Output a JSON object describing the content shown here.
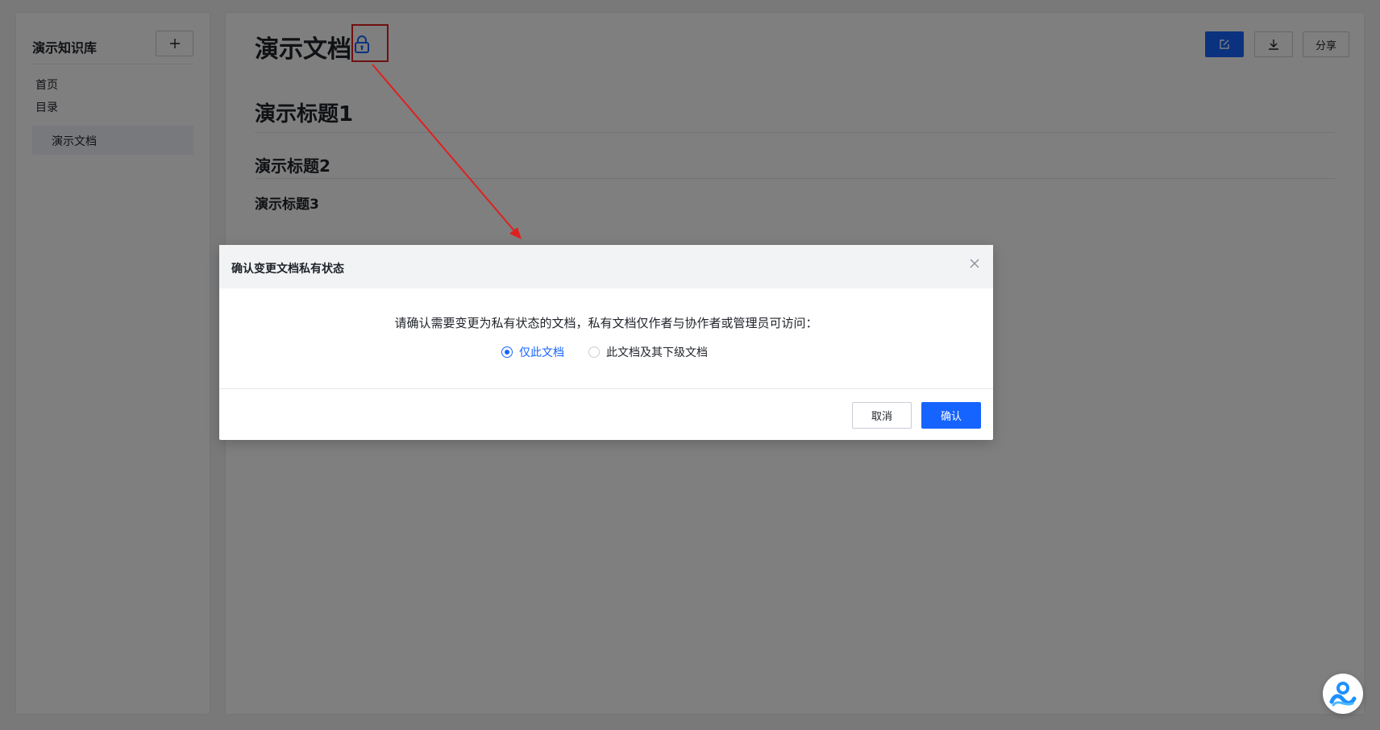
{
  "sidebar": {
    "title": "演示知识库",
    "nav": [
      "首页",
      "目录"
    ],
    "active_doc": "演示文档"
  },
  "main": {
    "doc_title": "演示文档",
    "toolbar": {
      "share_label": "分享"
    },
    "headings": [
      "演示标题1",
      "演示标题2",
      "演示标题3"
    ]
  },
  "modal": {
    "title": "确认变更文档私有状态",
    "message": "请确认需要变更为私有状态的文档，私有文档仅作者与协作者或管理员可访问：",
    "options": [
      {
        "label": "仅此文档",
        "checked": true
      },
      {
        "label": "此文档及其下级文档",
        "checked": false
      }
    ],
    "cancel_label": "取消",
    "confirm_label": "确认"
  },
  "colors": {
    "accent": "#1664ff",
    "annotation": "#e02020"
  },
  "icons": [
    "plus-icon",
    "lock-icon",
    "edit-icon",
    "download-icon",
    "close-icon",
    "assistant-icon"
  ]
}
